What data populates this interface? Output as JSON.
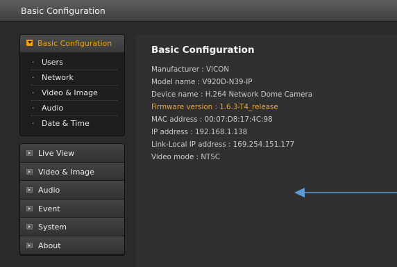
{
  "titlebar": {
    "title": "Basic Configuration"
  },
  "sidebar": {
    "section": {
      "label": "Basic Configuration",
      "icon": "checkbox-arrow-icon",
      "color": "#f0a000"
    },
    "subitems": [
      {
        "label": "Users"
      },
      {
        "label": "Network"
      },
      {
        "label": "Video & Image"
      },
      {
        "label": "Audio"
      },
      {
        "label": "Date & Time"
      }
    ],
    "nav": [
      {
        "label": "Live View"
      },
      {
        "label": "Video & Image"
      },
      {
        "label": "Audio"
      },
      {
        "label": "Event"
      },
      {
        "label": "System"
      },
      {
        "label": "About"
      }
    ]
  },
  "main": {
    "heading": "Basic Configuration",
    "info": [
      {
        "text": "Manufacturer : VICON",
        "highlight": false
      },
      {
        "text": "Model name : V920D-N39-IP",
        "highlight": false
      },
      {
        "text": "Device name : H.264 Network Dome Camera",
        "highlight": false
      },
      {
        "text": "Firmware version : 1.6.3-T4_release",
        "highlight": true
      },
      {
        "text": "MAC address : 00:07:D8:17:4C:98",
        "highlight": false
      },
      {
        "text": "IP address : 192.168.1.138",
        "highlight": false
      },
      {
        "text": "Link-Local IP address : 169.254.151.177",
        "highlight": false
      },
      {
        "text": "Video mode : NTSC",
        "highlight": false
      }
    ],
    "annotation_arrow_color": "#5b9bd5"
  }
}
